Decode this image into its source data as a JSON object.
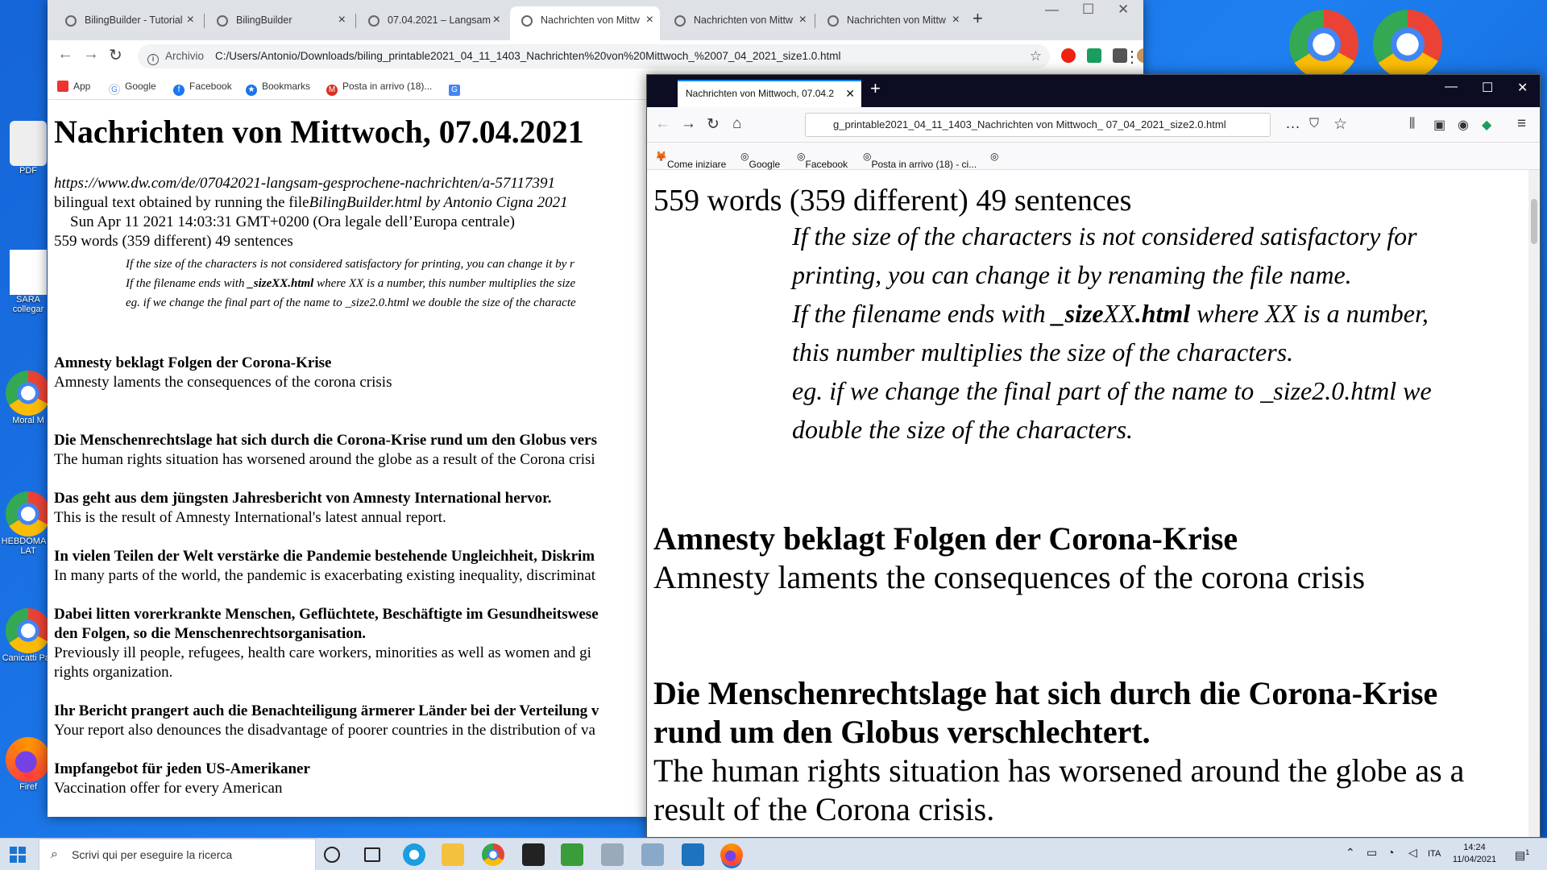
{
  "desktop": {
    "icons": [
      {
        "label": "PDF"
      },
      {
        "label": "SARA collegar"
      },
      {
        "label": "Moral M"
      },
      {
        "label": "HEBDOMA in LAT"
      },
      {
        "label": "Canicatti Pav"
      },
      {
        "label": "Firef"
      }
    ]
  },
  "chrome": {
    "tabs": [
      {
        "label": "BilingBuilder - Tutorial"
      },
      {
        "label": "BilingBuilder"
      },
      {
        "label": "07.04.2021 – Langsam"
      },
      {
        "label": "Nachrichten von Mittw"
      },
      {
        "label": "Nachrichten von Mittw"
      },
      {
        "label": "Nachrichten von Mittw"
      }
    ],
    "address_prefix": "Archivio",
    "url": "C:/Users/Antonio/Downloads/biling_printable2021_04_11_1403_Nachrichten%20von%20Mittwoch_%2007_04_2021_size1.0.html",
    "bookmarks": [
      "App",
      "Google",
      "Facebook",
      "Bookmarks",
      "Posta in arrivo (18)..."
    ],
    "page": {
      "title": "Nachrichten von Mittwoch, 07.04.2021",
      "source_url": "https://www.dw.com/de/07042021-langsam-gesprochene-nachrichten/a-57117391",
      "bilingual_prefix": "bilingual text obtained by running the file",
      "bilingual_tool": "BilingBuilder.html by Antonio Cigna 2021",
      "date": "Sun Apr 11 2021 14:03:31 GMT+0200 (Ora legale dell’Europa centrale)",
      "stats": "559 words (359 different) 49 sentences",
      "note1": "If the size of the characters is not considered satisfactory for printing, you can change it by r",
      "note2_prefix": "If the filename ends with ",
      "note2_bold": "_sizeXX.html",
      "note2_suffix": " where XX is a number, this number multiplies the size",
      "note3": "eg. if we change the final part of the name to _size2.0.html we double the size of the characte",
      "sentences": [
        {
          "de": "Amnesty beklagt Folgen der Corona-Krise",
          "en": "Amnesty laments the consequences of the corona crisis"
        },
        {
          "de": "Die Menschenrechtslage hat sich durch die Corona-Krise rund um den Globus vers",
          "en": "The human rights situation has worsened around the globe as a result of the Corona crisi"
        },
        {
          "de": "Das geht aus dem jüngsten Jahresbericht von Amnesty International hervor.",
          "en": "This is the result of Amnesty International's latest annual report."
        },
        {
          "de": "In vielen Teilen der Welt verstärke die Pandemie bestehende Ungleichheit, Diskrim",
          "en": "In many parts of the world, the pandemic is exacerbating existing inequality, discriminat"
        },
        {
          "de": "Dabei litten vorerkrankte Menschen, Geflüchtete, Beschäftigte im Gesundheitswese",
          "de2": "den Folgen, so die Menschenrechtsorganisation.",
          "en": "Previously ill people, refugees, health care workers, minorities as well as women and gi",
          "en2": "rights organization."
        },
        {
          "de": "Ihr Bericht prangert auch die Benachteiligung ärmerer Länder bei der Verteilung v",
          "en": "Your report also denounces the disadvantage of poorer countries in the distribution of va"
        },
        {
          "de": "Impfangebot für jeden US-Amerikaner",
          "en": "Vaccination offer for every American"
        }
      ]
    }
  },
  "firefox": {
    "tab_label": "Nachrichten von Mittwoch, 07.04.2",
    "url": "g_printable2021_04_11_1403_Nachrichten von Mittwoch_ 07_04_2021_size2.0.html",
    "bookmarks": [
      "Come iniziare",
      "Google",
      "Facebook",
      "Posta in arrivo (18) - ci..."
    ],
    "page": {
      "stats": "559 words (359 different) 49 sentences",
      "note_l1": "If the size of the characters is not considered satisfactory for",
      "note_l2": "printing, you can change it by renaming the file name.",
      "note_l3_prefix": "If the filename ends with ",
      "note_l3_bold": "_size",
      "note_l3_mid": "XX",
      "note_l3_bold2": ".html",
      "note_l3_suffix": " where XX is a number,",
      "note_l4": "this number multiplies the size of the characters.",
      "note_l5": "eg. if we change the final part of the name to _size2.0.html we",
      "note_l6": "double the size of the characters.",
      "s1_de": "Amnesty beklagt Folgen der Corona-Krise",
      "s1_en": "Amnesty laments the consequences of the corona crisis",
      "s2_de1": "Die Menschenrechtslage hat sich durch die Corona-Krise",
      "s2_de2": "rund um den Globus verschlechtert.",
      "s2_en1": "The human rights situation has worsened around the globe as a",
      "s2_en2": "result of the Corona crisis."
    }
  },
  "taskbar": {
    "search_placeholder": "Scrivi qui per eseguire la ricerca",
    "language": "ITA",
    "time": "14:24",
    "date": "11/04/2021",
    "notifications": "1"
  }
}
